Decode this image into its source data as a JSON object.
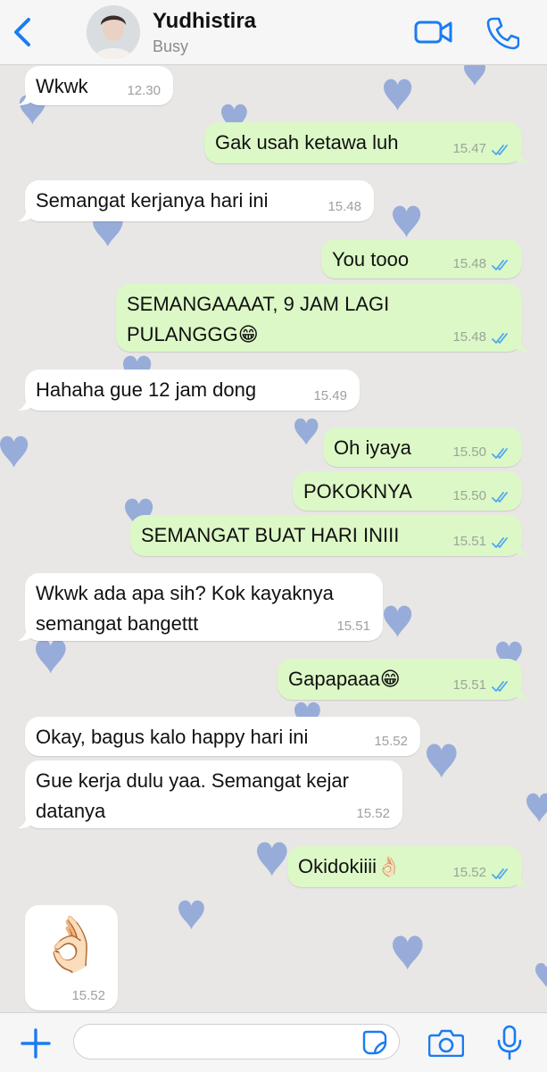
{
  "header": {
    "contact_name": "Yudhistira",
    "status": "Busy",
    "accent_color": "#1a7cf2"
  },
  "messages": [
    {
      "dir": "in",
      "text": "Wkwk",
      "time": "12.30"
    },
    {
      "dir": "out",
      "text": "Gak usah ketawa luh",
      "time": "15.47"
    },
    {
      "dir": "in",
      "text": "Semangat kerjanya hari ini",
      "time": "15.48"
    },
    {
      "dir": "out",
      "text": "You tooo",
      "time": "15.48"
    },
    {
      "dir": "out",
      "text": "SEMANGAAAAT, 9 JAM LAGI\nPULANGGG😁",
      "time": "15.48"
    },
    {
      "dir": "in",
      "text": "Hahaha gue 12 jam dong",
      "time": "15.49"
    },
    {
      "dir": "out",
      "text": "Oh iyaya",
      "time": "15.50"
    },
    {
      "dir": "out",
      "text": "POKOKNYA",
      "time": "15.50"
    },
    {
      "dir": "out",
      "text": "SEMANGAT BUAT HARI INIII",
      "time": "15.51"
    },
    {
      "dir": "in",
      "text": "Wkwk ada apa sih? Kok kayaknya\nsemangat bangettt",
      "time": "15.51"
    },
    {
      "dir": "out",
      "text": "Gapapaaa😁",
      "time": "15.51"
    },
    {
      "dir": "in",
      "text": "Okay, bagus kalo happy hari ini",
      "time": "15.52"
    },
    {
      "dir": "in",
      "text": "Gue kerja dulu yaa. Semangat kejar\ndatanya",
      "time": "15.52"
    },
    {
      "dir": "out",
      "text": "Okidokiiii👌🏻",
      "time": "15.52"
    },
    {
      "dir": "in",
      "text": "👌🏻",
      "time": "15.52",
      "emoji_only": true
    }
  ],
  "composer": {
    "placeholder": ""
  },
  "icons": {
    "back": "chevron-left-icon",
    "video": "video-camera-icon",
    "call": "phone-icon",
    "plus": "plus-icon",
    "sticker": "sticker-icon",
    "camera": "camera-icon",
    "mic": "microphone-icon",
    "read_receipt": "double-check-icon"
  },
  "colors": {
    "outgoing_bubble": "#dcf8c6",
    "incoming_bubble": "#ffffff",
    "read_ticks": "#4fa7f0",
    "heart_pattern": "#7c98d4"
  }
}
